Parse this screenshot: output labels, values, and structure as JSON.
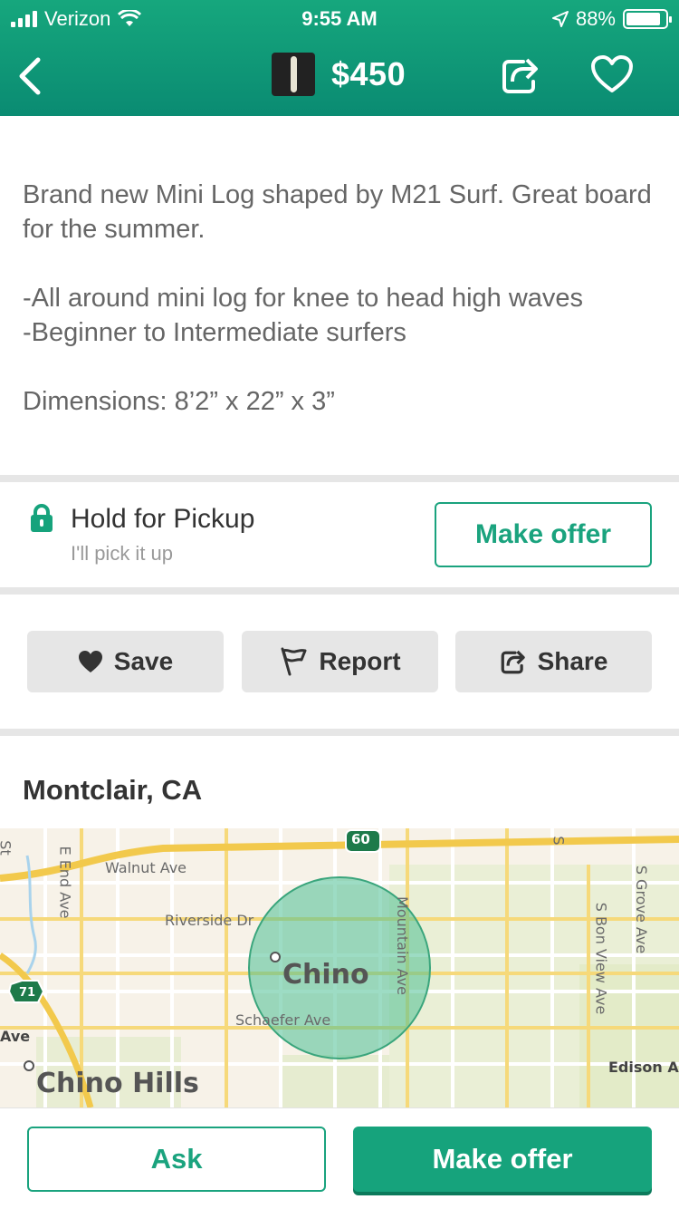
{
  "status_bar": {
    "carrier": "Verizon",
    "time": "9:55 AM",
    "battery": "88%",
    "battery_level": 0.88
  },
  "nav": {
    "price": "$450",
    "icons": [
      "back-chevron-icon",
      "share-icon",
      "heart-icon"
    ]
  },
  "description": {
    "para1": "Brand new Mini Log shaped by M21 Surf. Great board for the summer.",
    "line1": "-All around mini log for knee to head high waves",
    "line2": "-Beginner to Intermediate surfers",
    "dimensions": "Dimensions: 8’2” x 22” x 3”"
  },
  "hold": {
    "title": "Hold for Pickup",
    "subtitle": "I'll pick it up",
    "button": "Make offer"
  },
  "actions": {
    "save": "Save",
    "report": "Report",
    "share": "Share"
  },
  "location": {
    "title": "Montclair, CA",
    "map": {
      "streets": {
        "walnut": "Walnut Ave",
        "riverside": "Riverside Dr",
        "schaefer": "Schaefer Ave",
        "mountain": "Mountain Ave",
        "e_end": "E End Ave",
        "s_grove": "S Grove Ave",
        "s_bon_view": "S Bon View Ave",
        "edison": "Edison A",
        "st_left": "St",
        "ave_left": "Ave",
        "s_top": "S"
      },
      "shields": {
        "route60": "60",
        "route71": "71"
      },
      "cities": {
        "chino": "Chino",
        "chino_hills": "Chino Hills"
      }
    }
  },
  "bottom": {
    "ask": "Ask",
    "make_offer": "Make offer"
  },
  "colors": {
    "brand_green": "#16a37c",
    "header_top": "#16a77d",
    "header_bottom": "#0a8b72",
    "map_circle": "#4cbf94"
  }
}
